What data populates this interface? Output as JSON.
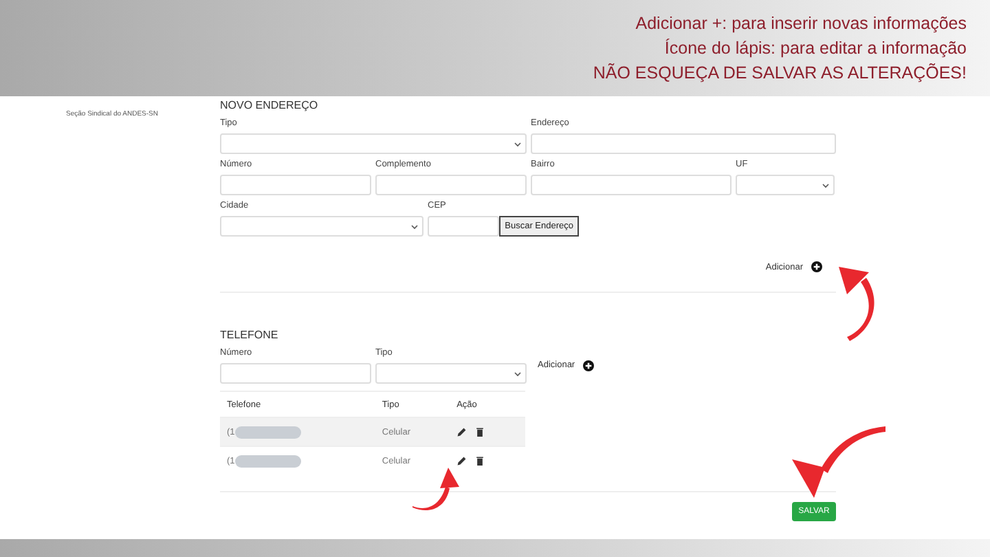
{
  "banner": {
    "lines": [
      "Adicionar +: para inserir novas informações",
      "Ícone do lápis: para editar a informação",
      "NÃO ESQUEÇA DE SALVAR AS ALTERAÇÕES!"
    ]
  },
  "logo": {
    "subtitle": "Seção Sindical do ANDES-SN"
  },
  "address": {
    "title": "NOVO ENDEREÇO",
    "fields": [
      {
        "label": "Tipo",
        "kind": "select"
      },
      {
        "label": "Endereço",
        "kind": "text"
      },
      {
        "label": "Número",
        "kind": "text"
      },
      {
        "label": "Complemento",
        "kind": "text"
      },
      {
        "label": "Bairro",
        "kind": "text"
      },
      {
        "label": "UF",
        "kind": "select"
      },
      {
        "label": "Cidade",
        "kind": "select"
      },
      {
        "label": "CEP",
        "kind": "text"
      }
    ],
    "search_button": "Buscar Endereço",
    "add_label": "Adicionar"
  },
  "phone": {
    "title": "TELEFONE",
    "fields": [
      {
        "label": "Número",
        "kind": "text"
      },
      {
        "label": "Tipo",
        "kind": "select"
      }
    ],
    "add_label": "Adicionar",
    "table": {
      "columns": [
        "Telefone",
        "Tipo",
        "Ação"
      ],
      "rows": [
        {
          "telefone": "(1",
          "tipo": "Celular"
        },
        {
          "telefone": "(1",
          "tipo": "Celular"
        }
      ]
    }
  },
  "save_button": "SALVAR"
}
